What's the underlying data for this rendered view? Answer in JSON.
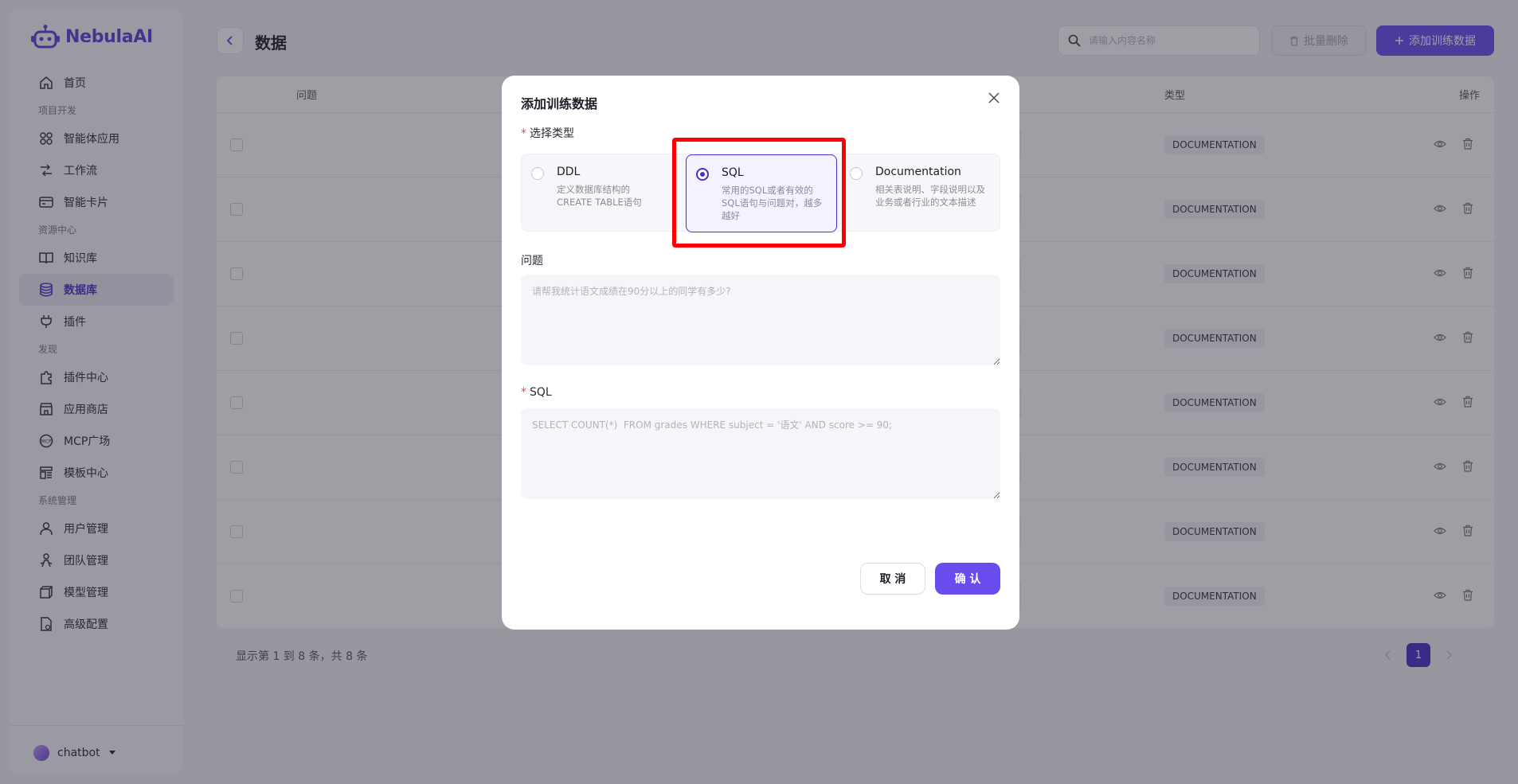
{
  "app": {
    "name": "NebulaAI",
    "brand_color": "#5b3fd6"
  },
  "sidebar": {
    "items": [
      {
        "type": "item",
        "label": "首页",
        "icon": "home-icon"
      },
      {
        "type": "section",
        "label": "项目开发"
      },
      {
        "type": "item",
        "label": "智能体应用",
        "icon": "apps-icon"
      },
      {
        "type": "item",
        "label": "工作流",
        "icon": "workflow-icon"
      },
      {
        "type": "item",
        "label": "智能卡片",
        "icon": "card-icon"
      },
      {
        "type": "section",
        "label": "资源中心"
      },
      {
        "type": "item",
        "label": "知识库",
        "icon": "book-icon"
      },
      {
        "type": "item",
        "label": "数据库",
        "icon": "database-icon",
        "active": true
      },
      {
        "type": "item",
        "label": "插件",
        "icon": "plug-icon"
      },
      {
        "type": "section",
        "label": "发现"
      },
      {
        "type": "item",
        "label": "插件中心",
        "icon": "puzzle-icon"
      },
      {
        "type": "item",
        "label": "应用商店",
        "icon": "store-icon"
      },
      {
        "type": "item",
        "label": "MCP广场",
        "icon": "mcp-icon"
      },
      {
        "type": "item",
        "label": "模板中心",
        "icon": "template-icon"
      },
      {
        "type": "section",
        "label": "系统管理"
      },
      {
        "type": "item",
        "label": "用户管理",
        "icon": "user-icon"
      },
      {
        "type": "item",
        "label": "团队管理",
        "icon": "team-icon"
      },
      {
        "type": "item",
        "label": "模型管理",
        "icon": "model-icon"
      },
      {
        "type": "item",
        "label": "高级配置",
        "icon": "settings-file-icon"
      }
    ],
    "user": {
      "name": "chatbot"
    }
  },
  "header": {
    "title": "数据",
    "search_placeholder": "请输入内容名称",
    "batch_delete_label": "批量删除",
    "add_label": "添加训练数据"
  },
  "table": {
    "columns": {
      "question": "问题",
      "type": "类型",
      "actions": "操作"
    },
    "rows": [
      {
        "type": "DOCUMENTATION"
      },
      {
        "type": "DOCUMENTATION"
      },
      {
        "type": "DOCUMENTATION"
      },
      {
        "type": "DOCUMENTATION"
      },
      {
        "type": "DOCUMENTATION"
      },
      {
        "type": "DOCUMENTATION"
      },
      {
        "type": "DOCUMENTATION"
      },
      {
        "type": "DOCUMENTATION"
      }
    ],
    "pagination": {
      "summary": "显示第 1 到 8 条，共 8 条",
      "current_page": "1"
    }
  },
  "modal": {
    "title": "添加训练数据",
    "type_label": "选择类型",
    "types": [
      {
        "title": "DDL",
        "desc": "定义数据库结构的CREATE TABLE语句",
        "selected": false
      },
      {
        "title": "SQL",
        "desc": "常用的SQL或者有效的SQL语句与问题对，越多越好",
        "selected": true
      },
      {
        "title": "Documentation",
        "desc": "相关表说明、字段说明以及业务或者行业的文本描述",
        "selected": false
      }
    ],
    "question_label": "问题",
    "question_placeholder": "请帮我统计语文成绩在90分以上的同学有多少?",
    "sql_label": "SQL",
    "sql_placeholder": "SELECT COUNT(*)  FROM grades WHERE subject = '语文' AND score >= 90;",
    "cancel_label": "取 消",
    "confirm_label": "确 认"
  }
}
